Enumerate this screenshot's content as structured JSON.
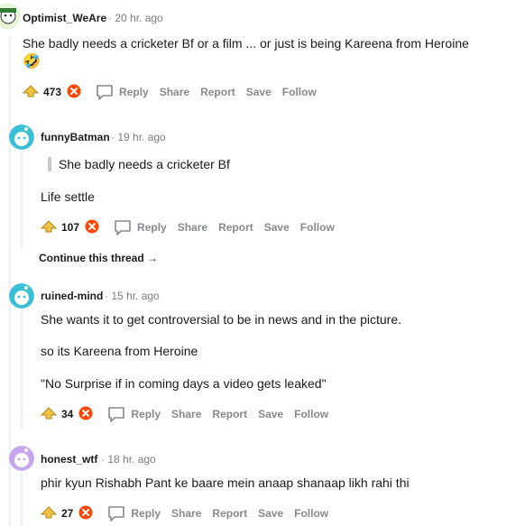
{
  "comments": [
    {
      "username": "Optimist_WeAre",
      "time": "20 hr. ago",
      "body": "She badly needs a cricketer Bf or a film ... or just is being Kareena from Heroine",
      "emoji": "🤣",
      "votes": "473"
    },
    {
      "username": "funnyBatman",
      "time": "19 hr. ago",
      "quote": "She badly needs a cricketer Bf",
      "body": "Life settle",
      "votes": "107"
    },
    {
      "username": "ruined-mind",
      "time": "15 hr. ago",
      "lines": [
        "She wants it to get controversial to be in news and in the picture.",
        "so its Kareena from Heroine",
        "\"No Surprise if in coming days a video gets leaked\""
      ],
      "votes": "34"
    },
    {
      "username": "honest_wtf",
      "time": "18 hr. ago",
      "body": "phir kyun Rishabh Pant ke baare mein anaap shanaap likh rahi thi",
      "votes": "27"
    }
  ],
  "actions": {
    "reply": "Reply",
    "share": "Share",
    "report": "Report",
    "save": "Save",
    "follow": "Follow"
  },
  "continue_thread": "Continue this thread",
  "continue_arrow": "→",
  "dot": "·",
  "colors": {
    "upvote_icon": "#c9a227",
    "downvote_badge": "#ff4500",
    "thread_line": "#edeff1",
    "avatar_teal": "#3bc0d6",
    "avatar_purple": "#c6a6ee"
  },
  "icons": [
    "snoo-avatar-icon",
    "upvote-icon",
    "downvote-icon",
    "reply-bubble-icon",
    "continue-arrow-icon"
  ]
}
